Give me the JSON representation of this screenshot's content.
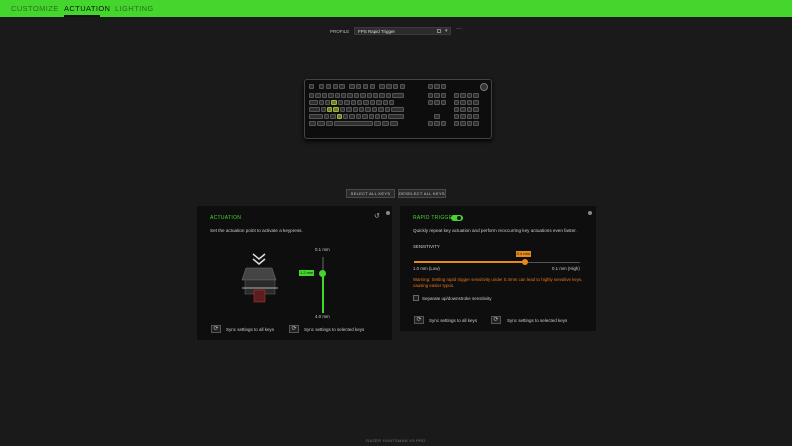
{
  "tabs": [
    {
      "label": "CUSTOMIZE"
    },
    {
      "label": "ACTUATION"
    },
    {
      "label": "LIGHTING"
    }
  ],
  "active_tab": "ACTUATION",
  "profile": {
    "label": "PROFILE",
    "value": "FPS Rapid Trigger",
    "more": "···"
  },
  "actions": {
    "select_all": "SELECT ALL KEYS",
    "deselect_all": "DESELECT ALL KEYS"
  },
  "actuation": {
    "title": "ACTUATION",
    "description": "Set the actuation point to activate a keypress.",
    "top_label": "0.1 mm",
    "bottom_label": "4.0 mm",
    "current_value": "1.2 mm",
    "value_mm": 1.2,
    "range_mm": [
      0.1,
      4.0
    ],
    "sync_all": "Sync settings to all keys",
    "sync_selected": "Sync settings to selected keys"
  },
  "rapid_trigger": {
    "title": "RAPID TRIGGER",
    "enabled": true,
    "description": "Quickly repeat key actuation and perform reoccurring key actuations even faster.",
    "sensitivity_label": "SENSITIVITY",
    "min_label": "1.0 mm (Low)",
    "max_label": "0.1 mm (High)",
    "current_value": "0.4 mm",
    "value_mm": 0.4,
    "range_mm": [
      1.0,
      0.1
    ],
    "warning": "Warning: Setting rapid trigger sensitivity under 0.4mm can lead to highly sensitive keys, causing easier typos.",
    "checkbox_label": "Separate up/downstroke sensitivity",
    "sync_all": "Sync settings to all keys",
    "sync_selected": "Sync settings to selected keys"
  },
  "footer": "RAZER HUNTSMAN V3 PRO",
  "colors": {
    "accent": "#44d62c",
    "warning": "#e8771a",
    "background": "#1a1a1a",
    "panel": "#0e0e0e"
  }
}
